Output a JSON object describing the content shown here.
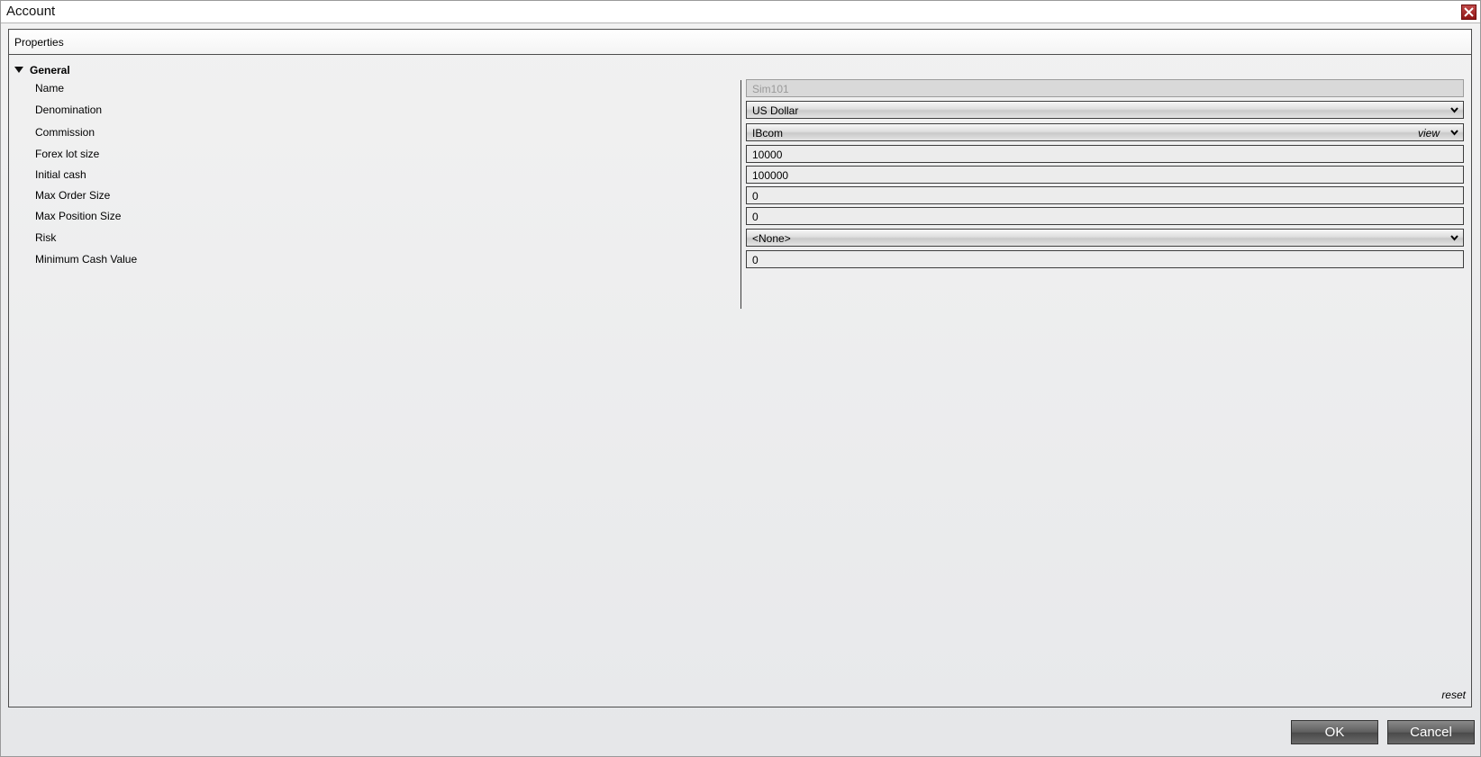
{
  "window": {
    "title": "Account",
    "close_icon": "close-icon"
  },
  "panel": {
    "title": "Properties",
    "group": {
      "label": "General",
      "expanded": true
    },
    "properties": {
      "name": {
        "label": "Name",
        "value": "Sim101",
        "disabled": true
      },
      "denomination": {
        "label": "Denomination",
        "value": "US Dollar"
      },
      "commission": {
        "label": "Commission",
        "value": "IBcom",
        "link": "view"
      },
      "forex_lot_size": {
        "label": "Forex lot size",
        "value": "10000"
      },
      "initial_cash": {
        "label": "Initial cash",
        "value": "100000"
      },
      "max_order_size": {
        "label": "Max Order Size",
        "value": "0"
      },
      "max_position_size": {
        "label": "Max Position Size",
        "value": "0"
      },
      "risk": {
        "label": "Risk",
        "value": "<None>"
      },
      "minimum_cash_value": {
        "label": "Minimum Cash Value",
        "value": "0"
      }
    },
    "reset_label": "reset"
  },
  "buttons": {
    "ok": "OK",
    "cancel": "Cancel"
  },
  "colors": {
    "close_button": "#a52a2a",
    "button_dark": "#5e5e5e"
  }
}
